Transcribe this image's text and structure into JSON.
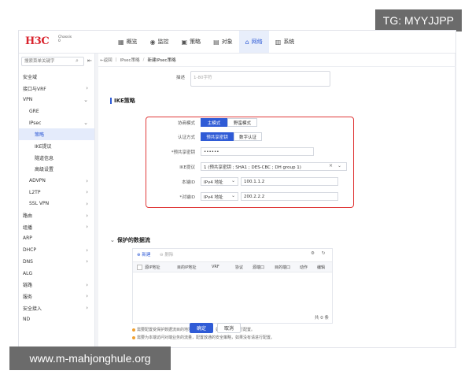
{
  "watermarks": {
    "top": "TG: MYYJJPP",
    "bottom": "www.m-mahjonghule.org"
  },
  "brand": {
    "logo_h3c": "H3C",
    "chassis": "Chassis",
    "chassis_num": "0"
  },
  "nav": [
    {
      "label": "概览",
      "icon": "dashboard-icon"
    },
    {
      "label": "监控",
      "icon": "monitor-icon"
    },
    {
      "label": "策略",
      "icon": "policy-icon"
    },
    {
      "label": "对象",
      "icon": "object-icon"
    },
    {
      "label": "网络",
      "icon": "network-icon",
      "active": true
    },
    {
      "label": "系统",
      "icon": "system-icon"
    }
  ],
  "sidebar": {
    "search_placeholder": "搜索菜单关键字",
    "items": [
      {
        "label": "安全域",
        "level": 0,
        "chevron": ""
      },
      {
        "label": "接口与VRF",
        "level": 0,
        "chevron": "›"
      },
      {
        "label": "VPN",
        "level": 0,
        "chevron": "⌄"
      },
      {
        "label": "GRE",
        "level": 1,
        "chevron": ""
      },
      {
        "label": "IPsec",
        "level": 1,
        "chevron": "⌄"
      },
      {
        "label": "策略",
        "level": 2,
        "chevron": "",
        "active": true
      },
      {
        "label": "IKE提议",
        "level": 2,
        "chevron": ""
      },
      {
        "label": "隧道信息",
        "level": 2,
        "chevron": ""
      },
      {
        "label": "高级设置",
        "level": 2,
        "chevron": ""
      },
      {
        "label": "ADVPN",
        "level": 1,
        "chevron": "›"
      },
      {
        "label": "L2TP",
        "level": 1,
        "chevron": "›"
      },
      {
        "label": "SSL VPN",
        "level": 1,
        "chevron": "›"
      },
      {
        "label": "路由",
        "level": 0,
        "chevron": "›"
      },
      {
        "label": "组播",
        "level": 0,
        "chevron": "›"
      },
      {
        "label": "ARP",
        "level": 0,
        "chevron": ""
      },
      {
        "label": "DHCP",
        "level": 0,
        "chevron": "›"
      },
      {
        "label": "DNS",
        "level": 0,
        "chevron": "›"
      },
      {
        "label": "ALG",
        "level": 0,
        "chevron": ""
      },
      {
        "label": "链路",
        "level": 0,
        "chevron": "›"
      },
      {
        "label": "服务",
        "level": 0,
        "chevron": "›"
      },
      {
        "label": "安全接入",
        "level": 0,
        "chevron": "›"
      },
      {
        "label": "ND",
        "level": 0,
        "chevron": ""
      }
    ]
  },
  "breadcrumb": {
    "back": "←返回",
    "parent": "IPsec策略",
    "current": "新建IPsec策略"
  },
  "form": {
    "desc_label": "描述",
    "desc_placeholder": "1-80字符",
    "ike_section": "IKE策略",
    "negotiation_label": "协商模式",
    "mode_main": "主模式",
    "mode_aggressive": "野蛮模式",
    "auth_label": "认证方式",
    "auth_psk": "预共享密钥",
    "auth_cert": "数字认证",
    "psk_label": "*预共享密钥",
    "psk_value": "••••••",
    "proposal_label": "IKE提议",
    "proposal_value": "1 (预共享密钥 ; SHA1 ; DES-CBC ; DH group 1)",
    "local_id_label": "本端ID",
    "local_id_type": "IPv4 地址",
    "local_id_value": "100.1.1.2",
    "peer_id_label": "*对端ID",
    "peer_id_type": "IPv4 地址",
    "peer_id_value": "200.2.2.2",
    "flow_section": "保护的数据流"
  },
  "table": {
    "new_label": "新建",
    "delete_label": "删除",
    "columns": [
      "源IP地址",
      "目的IP地址",
      "VRF",
      "协议",
      "源端口",
      "目的端口",
      "动作",
      "编辑"
    ],
    "count_label": "共 0 条"
  },
  "notes": [
    "需要配置受保护数据流目的地址的路由信息，如果没有请进行配置。",
    "需要为本端访问对端业务的流量，配置放通的安全策略，如果没有请进行配置。"
  ],
  "buttons": {
    "ok": "确定",
    "cancel": "取消"
  }
}
